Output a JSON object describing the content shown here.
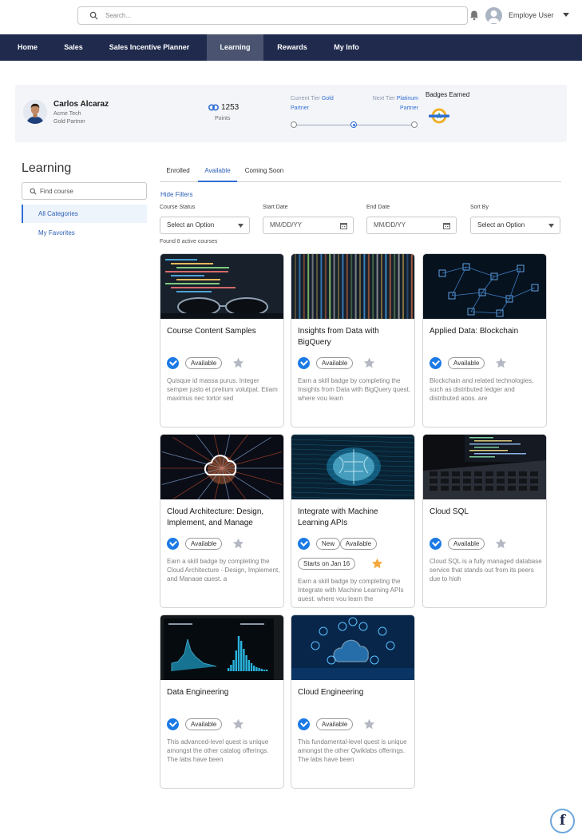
{
  "header": {
    "search_placeholder": "Search...",
    "user_name": "Employe User"
  },
  "nav": {
    "items": [
      {
        "label": "Home"
      },
      {
        "label": "Sales"
      },
      {
        "label": "Sales Incentive Planner"
      },
      {
        "label": "Learning",
        "active": true
      },
      {
        "label": "Rewards"
      },
      {
        "label": "My Info"
      }
    ]
  },
  "profile": {
    "name": "Carlos Alcaraz",
    "company": "Acme Tech",
    "tier": "Gold Partner",
    "points_value": "1253",
    "points_label": "Points",
    "current_tier_label": "Current Tier",
    "current_tier_value": "Gold",
    "current_tier_suffix": "Partner",
    "next_tier_label": "Next Tier",
    "next_tier_value": "Platinum",
    "next_tier_suffix": "Partner",
    "badges_label": "Badges Earned"
  },
  "sidebar": {
    "title": "Learning",
    "search_placeholder": "Find course",
    "items": [
      {
        "label": "All Categories",
        "active": true
      },
      {
        "label": "My Favorites"
      }
    ]
  },
  "tabs": [
    {
      "label": "Enrolled"
    },
    {
      "label": "Available",
      "active": true
    },
    {
      "label": "Coming Soon"
    }
  ],
  "filters": {
    "hide_label": "Hide Filters",
    "course_status_label": "Course Status",
    "course_status_value": "Select an Option",
    "start_date_label": "Start Date",
    "start_date_placeholder": "MM/DD/YY",
    "end_date_label": "End Date",
    "end_date_placeholder": "MM/DD/YY",
    "sort_by_label": "Sort By",
    "sort_by_value": "Select an Option"
  },
  "found_text": "Found 8 active courses",
  "colors": {
    "nav_bg": "#1f2a4d",
    "accent": "#2f6fd6",
    "check": "#1b7ae5",
    "star_off": "#b4b8c2",
    "star_on": "#f4a93c"
  },
  "courses": [
    {
      "title": "Course Content Samples",
      "chips": [
        "Available"
      ],
      "favorite": false,
      "description": "Quisque id massa purus. Integer semper justo et pretium volutpat. Etiam maximus nec tortor sed",
      "image": "code-glasses"
    },
    {
      "title": "Insights from Data with BigQuery",
      "chips": [
        "Available"
      ],
      "favorite": false,
      "description": "Earn a skill badge by completing the Insights from Data with BigQuery quest, where you learn",
      "image": "data-stream"
    },
    {
      "title": "Applied Data: Blockchain",
      "chips": [
        "Available"
      ],
      "favorite": false,
      "description": "Blockchain and related technologies, such as distributed ledger and distributed apps, are",
      "image": "blockchain"
    },
    {
      "title": "Cloud Architecture: Design, Implement, and Manage",
      "chips": [
        "Available"
      ],
      "favorite": false,
      "description": "Earn a skill badge by completing the Cloud Architecture - Design, Implement, and Manage quest, a",
      "image": "cloud-burst"
    },
    {
      "title": "Integrate with Machine Learning APIs",
      "chips": [
        "New",
        "Available"
      ],
      "extra_chip": "Starts on Jan 16",
      "favorite": true,
      "description": "Earn a skill badge by completing the Integrate with Machine Learning APIs quest, where you learn the",
      "image": "brain"
    },
    {
      "title": "Cloud SQL",
      "chips": [
        "Available"
      ],
      "favorite": false,
      "description": "Cloud SQL is a fully managed database service that stands out from its peers due to high",
      "image": "laptop"
    },
    {
      "title": "Data Engineering",
      "chips": [
        "Available"
      ],
      "favorite": false,
      "description": "This advanced-level quest is unique amongst the other catalog offerings. The labs have been",
      "image": "dashboard"
    },
    {
      "title": "Cloud Engineering",
      "chips": [
        "Available"
      ],
      "favorite": false,
      "description": "This fundamental-level quest is unique amongst the other Qwiklabs offerings. The labs have been",
      "image": "cloud-network"
    }
  ]
}
